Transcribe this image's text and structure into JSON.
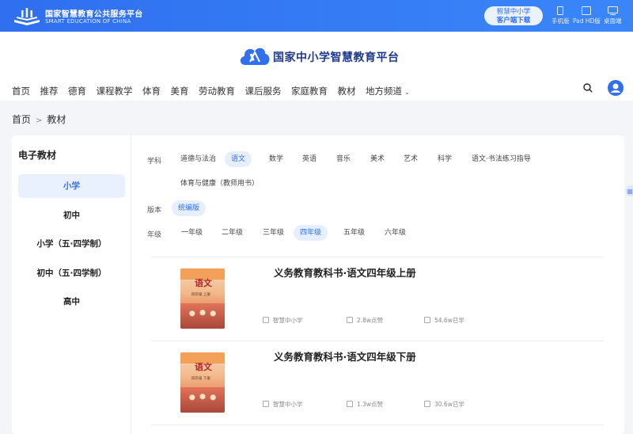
{
  "topbar": {
    "logo_cn": "国家智慧教育公共服务平台",
    "logo_en": "SMART EDUCATION OF CHINA",
    "download_line1": "智慧中小学",
    "download_line2": "客户端下载",
    "devices": [
      {
        "label": "手机版",
        "icon": "phone-icon"
      },
      {
        "label": "Pad HD版",
        "icon": "tablet-icon"
      },
      {
        "label": "桌面端",
        "icon": "desktop-icon"
      }
    ]
  },
  "header": {
    "brand": "国家中小学智慧教育平台",
    "nav": [
      "首页",
      "推荐",
      "德育",
      "课程教学",
      "体育",
      "美育",
      "劳动教育",
      "课后服务",
      "家庭教育",
      "教材",
      "地方频道"
    ]
  },
  "breadcrumb": {
    "home": "首页",
    "sep": ">",
    "current": "教材"
  },
  "sidebar": {
    "title": "电子教材",
    "items": [
      {
        "label": "小学",
        "active": true
      },
      {
        "label": "初中",
        "active": false
      },
      {
        "label": "小学（五·四学制）",
        "active": false
      },
      {
        "label": "初中（五·四学制）",
        "active": false
      },
      {
        "label": "高中",
        "active": false
      }
    ]
  },
  "filters": {
    "subject_label": "学科",
    "subjects": [
      "道德与法治",
      "语文",
      "数学",
      "英语",
      "音乐",
      "美术",
      "艺术",
      "科学",
      "语文·书法练习指导",
      "体育与健康（教师用书）"
    ],
    "subject_active": "语文",
    "edition_label": "版本",
    "editions": [
      "统编版"
    ],
    "edition_active": "统编版",
    "grade_label": "年级",
    "grades": [
      "一年级",
      "二年级",
      "三年级",
      "四年级",
      "五年级",
      "六年级"
    ],
    "grade_active": "四年级"
  },
  "books": [
    {
      "title": "义务教育教科书·语文四年级上册",
      "publisher": "智慧中小学",
      "likes": "2.8w点赞",
      "learners": "54.6w已学",
      "cover_title": "语文",
      "cover_sub": "四年级 上册"
    },
    {
      "title": "义务教育教科书·语文四年级下册",
      "publisher": "智慧中小学",
      "likes": "1.3w点赞",
      "learners": "30.6w已学",
      "cover_title": "语文",
      "cover_sub": "四年级 下册"
    }
  ],
  "colors": {
    "primary": "#2f6ff0",
    "active_bg": "#e6efff",
    "text": "#333333"
  }
}
